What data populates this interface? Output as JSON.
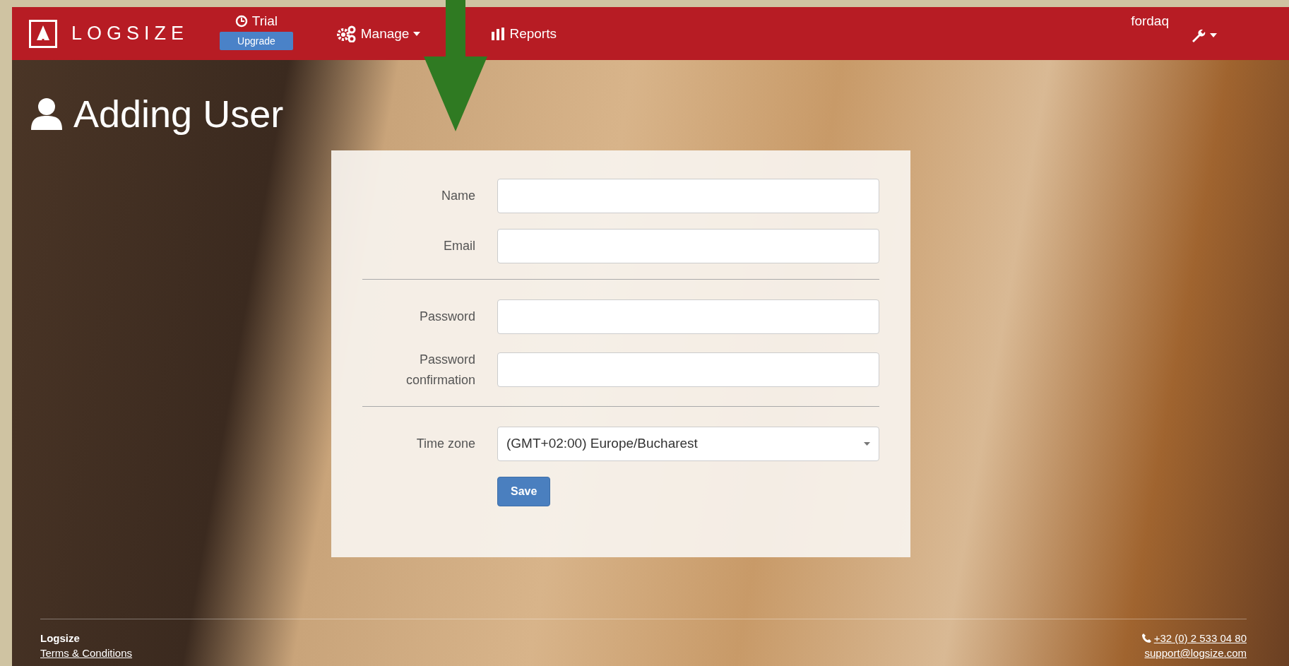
{
  "navbar": {
    "brand": "LOGSIZE",
    "trial": {
      "label": "Trial",
      "upgrade": "Upgrade"
    },
    "menu": [
      {
        "label": "Manage",
        "kind": "gears",
        "dropdown": true
      },
      {
        "label": "Reports",
        "kind": "bars",
        "dropdown": false
      }
    ],
    "user": "fordaq"
  },
  "page_title": "Adding User",
  "form": {
    "groups": [
      [
        {
          "label": "Name",
          "kind": "text"
        },
        {
          "label": "Email",
          "kind": "text"
        }
      ],
      [
        {
          "label": "Password",
          "kind": "password"
        },
        {
          "label": "Password confirmation",
          "kind": "password"
        }
      ],
      [
        {
          "label": "Time zone",
          "kind": "select",
          "value": "(GMT+02:00) Europe/Bucharest"
        }
      ]
    ],
    "submit": "Save"
  },
  "footer": {
    "company": "Logsize",
    "terms": "Terms & Conditions",
    "phone": "+32 (0) 2 533 04 80",
    "email": "support@logsize.com"
  }
}
